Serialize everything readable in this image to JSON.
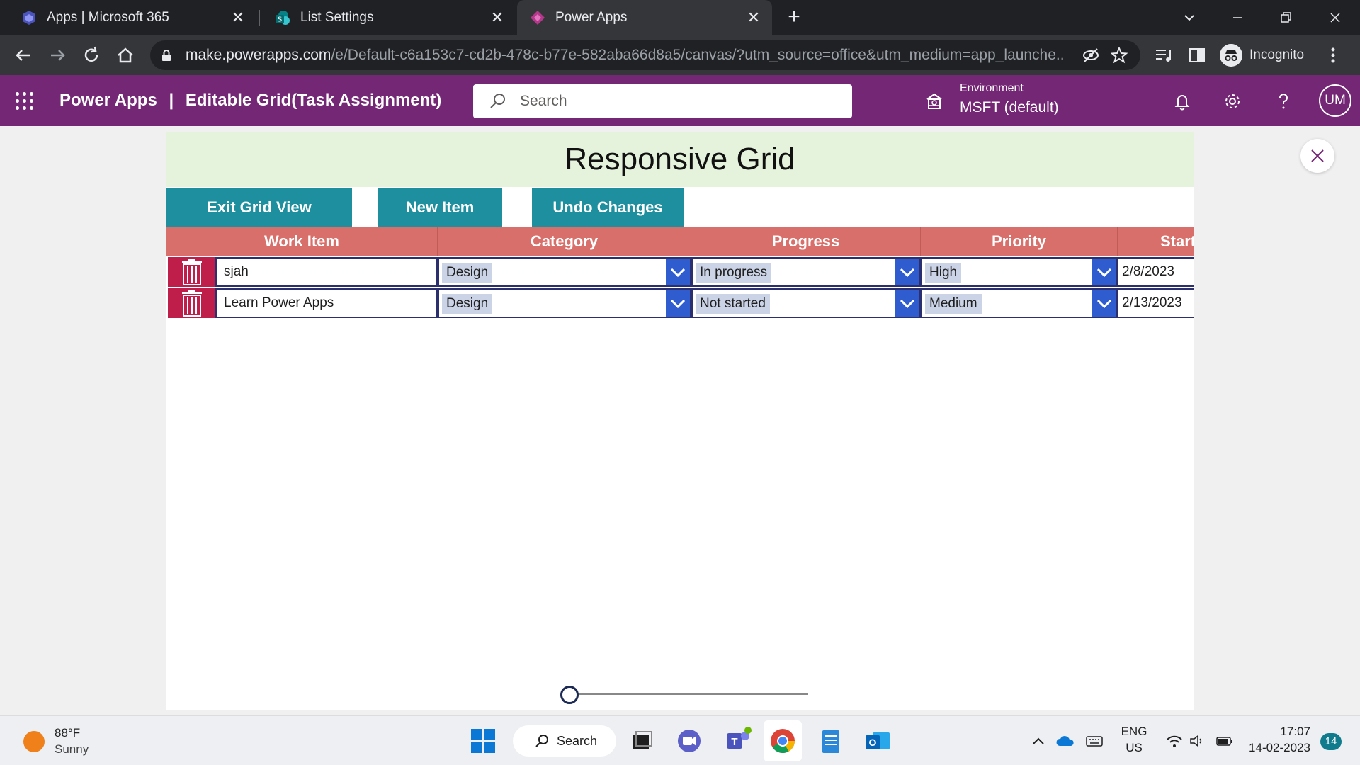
{
  "browser": {
    "tabs": [
      {
        "title": "Apps | Microsoft 365"
      },
      {
        "title": "List Settings"
      },
      {
        "title": "Power Apps"
      }
    ],
    "url_host": "make.powerapps.com",
    "url_path": "/e/Default-c6a153c7-cd2b-478c-b77e-582aba66d8a5/canvas/?utm_source=office&utm_medium=app_launche...",
    "profile_label": "Incognito"
  },
  "powerapps": {
    "brand": "Power Apps",
    "separator": "|",
    "app_name": "Editable Grid(Task Assignment)",
    "search_placeholder": "Search",
    "environment_label": "Environment",
    "environment_value": "MSFT (default)",
    "avatar_initials": "UM",
    "brand_color": "#742774"
  },
  "app": {
    "title": "Responsive Grid",
    "buttons": {
      "exit_grid": "Exit Grid View",
      "new_item": "New Item",
      "undo": "Undo Changes"
    },
    "columns": [
      "Work Item",
      "Category",
      "Progress",
      "Priority",
      "Start"
    ],
    "rows": [
      {
        "work_item": "sjah",
        "category": "Design",
        "progress": "In progress",
        "priority": "High",
        "start": "2/8/2023"
      },
      {
        "work_item": "Learn Power Apps",
        "category": "Design",
        "progress": "Not started",
        "priority": "Medium",
        "start": "2/13/2023"
      }
    ],
    "slider_value": 0
  },
  "taskbar": {
    "weather_temp": "88°F",
    "weather_condition": "Sunny",
    "search_label": "Search",
    "lang_line1": "ENG",
    "lang_line2": "US",
    "time": "17:07",
    "date": "14-02-2023",
    "notification_count": "14"
  }
}
